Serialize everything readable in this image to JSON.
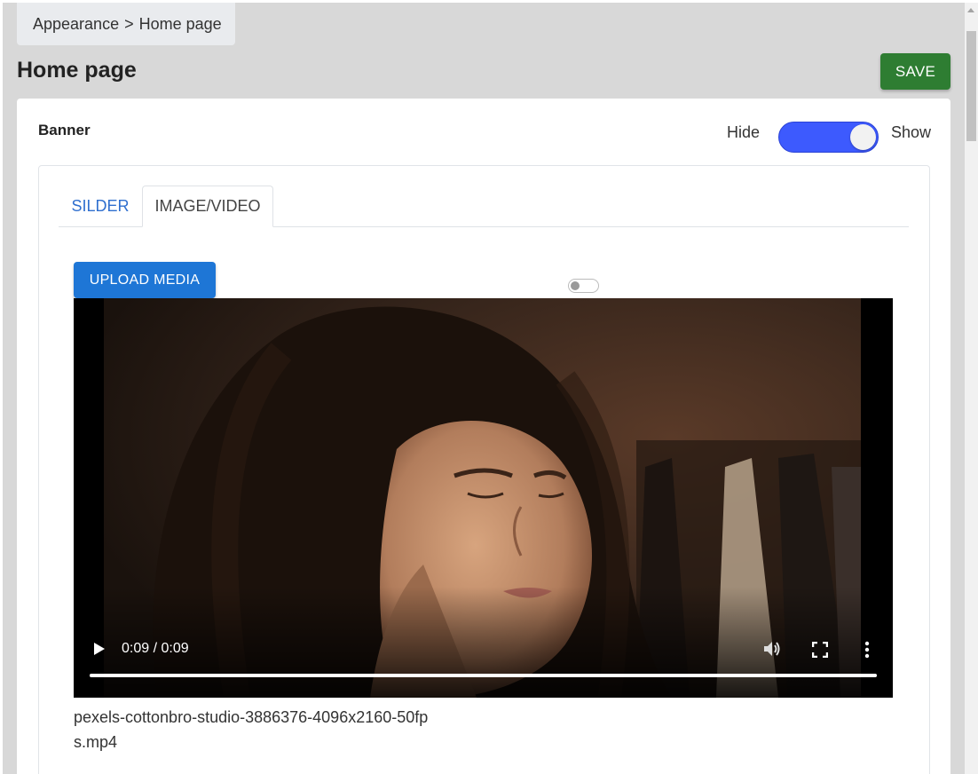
{
  "breadcrumb": {
    "section": "Appearance",
    "separator": ">",
    "page": "Home page"
  },
  "page": {
    "title": "Home page",
    "save_label": "SAVE"
  },
  "banner": {
    "label": "Banner",
    "toggle": {
      "off_label": "Hide",
      "on_label": "Show",
      "state": "on",
      "color": "#3d5afe"
    },
    "tabs": [
      {
        "label": "SILDER",
        "active": false
      },
      {
        "label": "IMAGE/VIDEO",
        "active": true
      }
    ],
    "upload_label": "UPLOAD MEDIA",
    "video": {
      "time": "0:09 / 0:09",
      "progress": 1.0,
      "filename": "pexels-cottonbro-studio-3886376-4096x2160-50fps.mp4"
    }
  },
  "colors": {
    "save": "#2e7d32",
    "upload": "#1e76d6",
    "tab_link": "#2f6fcf"
  }
}
